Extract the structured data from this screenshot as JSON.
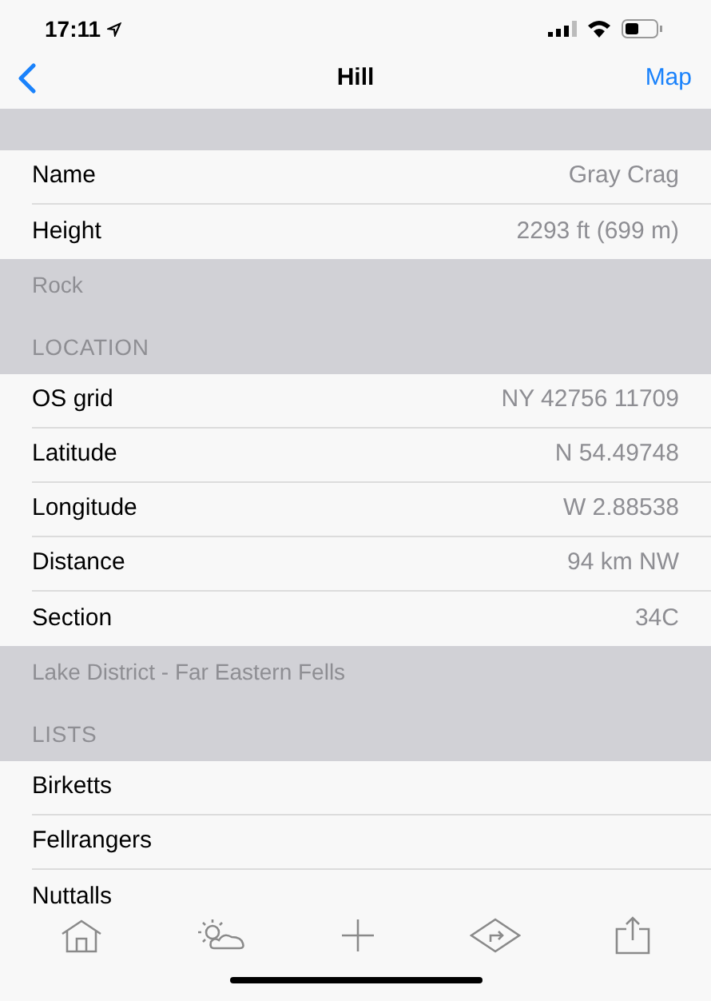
{
  "status_bar": {
    "time": "17:11"
  },
  "nav": {
    "title": "Hill",
    "right": "Map"
  },
  "groups": [
    {
      "rows": [
        {
          "label": "Name",
          "value": "Gray Crag"
        },
        {
          "label": "Height",
          "value": "2293 ft (699 m)"
        }
      ],
      "footer": "Rock"
    },
    {
      "header": "LOCATION",
      "rows": [
        {
          "label": "OS grid",
          "value": "NY 42756 11709"
        },
        {
          "label": "Latitude",
          "value": "N 54.49748"
        },
        {
          "label": "Longitude",
          "value": "W 2.88538"
        },
        {
          "label": "Distance",
          "value": "94 km NW"
        },
        {
          "label": "Section",
          "value": "34C"
        }
      ],
      "footer": "Lake District - Far Eastern Fells"
    },
    {
      "header": "LISTS",
      "rows": [
        {
          "label": "Birketts"
        },
        {
          "label": "Fellrangers"
        },
        {
          "label": "Nuttalls"
        }
      ]
    }
  ],
  "toolbar": [
    {
      "kind": "home"
    },
    {
      "kind": "weather"
    },
    {
      "kind": "add"
    },
    {
      "kind": "directions"
    },
    {
      "kind": "share"
    }
  ]
}
